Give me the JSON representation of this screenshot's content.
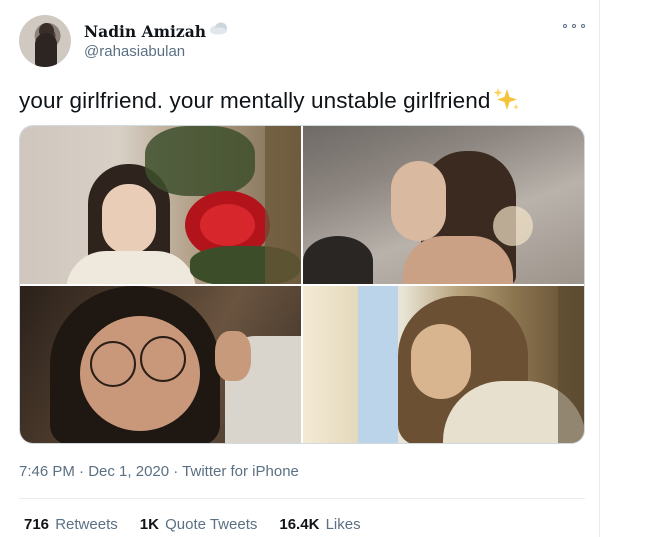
{
  "tweet": {
    "author": {
      "display_name": "Nadin Amizah",
      "handle": "@rahasiabulan",
      "badge_icon": "cloud-icon"
    },
    "text": "your girlfriend. your mentally unstable girlfriend",
    "text_emoji_icon": "sparkles-icon",
    "media_count": 4,
    "timestamp": {
      "time": "7:46 PM",
      "separator1": " · ",
      "date": "Dec 1, 2020",
      "separator2": " · ",
      "source": "Twitter for iPhone"
    },
    "stats": {
      "retweets": {
        "count": "716",
        "label": "Retweets"
      },
      "quote_tweets": {
        "count": "1K",
        "label": "Quote Tweets"
      },
      "likes": {
        "count": "16.4K",
        "label": "Likes"
      }
    }
  },
  "colors": {
    "text_primary": "#0f1419",
    "text_secondary": "#5b7083",
    "border": "#e6ecf0",
    "sparkle": "#f5c33b"
  }
}
